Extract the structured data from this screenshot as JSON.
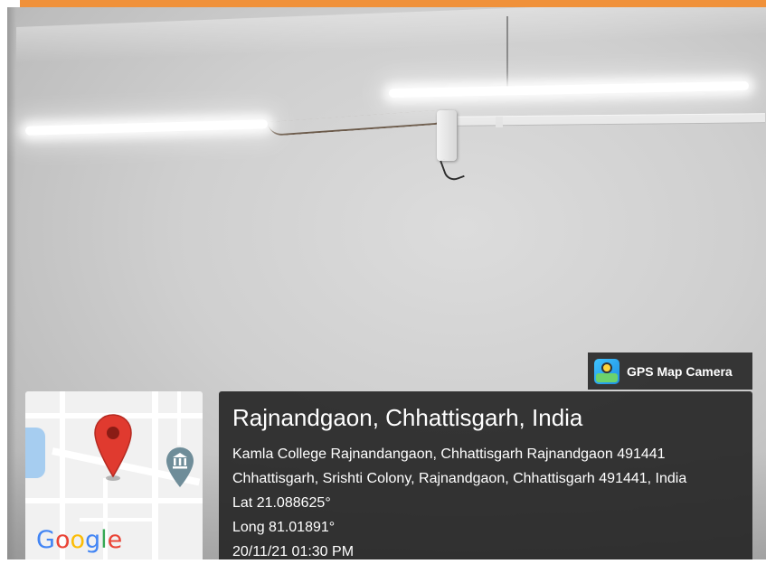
{
  "colors": {
    "top_accent": "#f0913a",
    "panel_bg": "#262626",
    "pin_red": "#e03a2f",
    "landmark_slate": "#6f8d99"
  },
  "gps_badge": {
    "label": "GPS Map Camera",
    "icon": "gps-map-camera-app-icon"
  },
  "map": {
    "logo_text": [
      "G",
      "o",
      "o",
      "g",
      "l",
      "e"
    ],
    "pin_icon": "map-pin-icon",
    "landmark_icon": "museum-landmark-icon"
  },
  "location": {
    "title": "Rajnandgaon, Chhattisgarh, India",
    "address_line1": "Kamla College Rajnandangaon, Chhattisgarh Rajnandgaon 491441",
    "address_line2": "Chhattisgarh, Srishti Colony, Rajnandgaon, Chhattisgarh 491441, India",
    "latitude": "Lat 21.088625°",
    "longitude": "Long 81.01891°",
    "datetime": "20/11/21 01:30 PM"
  }
}
